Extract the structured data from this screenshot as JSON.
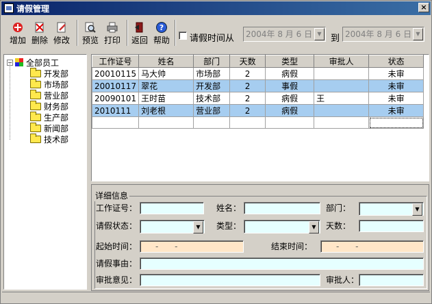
{
  "window": {
    "title": "请假管理",
    "close_glyph": "×"
  },
  "toolbar": {
    "add": "增加",
    "delete": "删除",
    "edit": "修改",
    "preview": "预览",
    "print": "打印",
    "back": "返回",
    "help": "帮助",
    "leave_time_from": "请假时间从",
    "date_from": "2004年 8 月 6 日",
    "to": "到",
    "date_to": "2004年 8 月 6 日"
  },
  "tree": {
    "root": "全部员工",
    "items": [
      "开发部",
      "市场部",
      "营业部",
      "财务部",
      "生产部",
      "新闻部",
      "技术部"
    ]
  },
  "table": {
    "headers": [
      "工作证号",
      "姓名",
      "部门",
      "天数",
      "类型",
      "审批人",
      "状态"
    ],
    "rows": [
      [
        "20010115",
        "马大帅",
        "市场部",
        "2",
        "病假",
        "",
        "未审"
      ],
      [
        "20010117",
        "翠花",
        "开发部",
        "2",
        "事假",
        "",
        "未审"
      ],
      [
        "20090101",
        "王时苗",
        "技术部",
        "2",
        "病假",
        "王",
        "未审"
      ],
      [
        "2010111",
        "刘老根",
        "营业部",
        "2",
        "病假",
        "",
        "未审"
      ]
    ]
  },
  "detail": {
    "legend": "详细信息",
    "id_label": "工作证号：",
    "name_label": "姓名：",
    "dept_label": "部门：",
    "status_label": "请假状态：",
    "type_label": "类型：",
    "days_label": "天数：",
    "start_label": "起始时间：",
    "start_value": "- -",
    "end_label": "结束时间：",
    "end_value": "- -",
    "reason_label": "请假事由：",
    "opinion_label": "审批意见：",
    "approver_label": "审批人："
  },
  "colors": {
    "title_bar": "#0a246a",
    "selected_row": "#a6cdf0",
    "input_bg": "#e6ffff",
    "date_input_bg": "#ffe6c8"
  }
}
